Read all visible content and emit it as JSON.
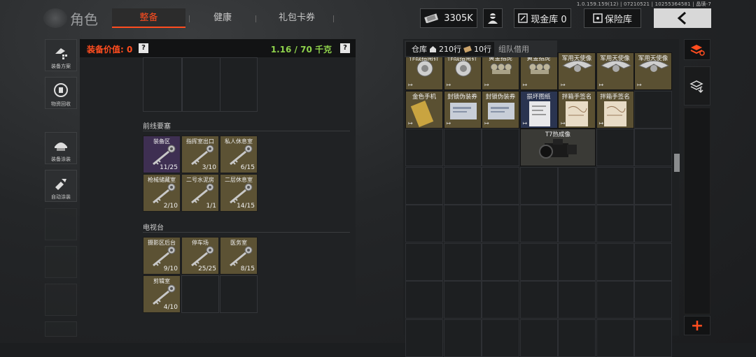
{
  "header": {
    "version": "1.0.159.159(12) | 07210521 | 10255364581 | 晶璜-7",
    "title": "角色",
    "tabs": [
      {
        "label": "整备",
        "active": true
      },
      {
        "label": "健康",
        "active": false
      },
      {
        "label": "礼包卡券",
        "active": false
      }
    ],
    "currency": "3305K",
    "cash_vault": "现金库 0",
    "safe_box": "保险库"
  },
  "sidebar": {
    "items": [
      {
        "label": "装备方案",
        "icon": "armor-plan-icon"
      },
      {
        "label": "物资回收",
        "icon": "recycle-icon"
      },
      {
        "label": "装备涂装",
        "icon": "helmet-paint-icon"
      },
      {
        "label": "自动涂装",
        "icon": "auto-paint-icon"
      }
    ]
  },
  "equipment": {
    "value_label": "装备价值: 0",
    "weight": "1.16 / 70 千克",
    "help": "?",
    "sections": [
      {
        "title": "前线要塞",
        "keys": [
          {
            "name": "装备区",
            "count": "11/25",
            "rarity": "purple"
          },
          {
            "name": "指挥室出口",
            "count": "3/10",
            "rarity": "gold"
          },
          {
            "name": "私人休息室",
            "count": "6/15",
            "rarity": "gold"
          },
          {
            "name": "枪械储藏室",
            "count": "2/10",
            "rarity": "gold"
          },
          {
            "name": "二号水泥房",
            "count": "1/1",
            "rarity": "gold"
          },
          {
            "name": "二层休息室",
            "count": "14/15",
            "rarity": "gold"
          }
        ]
      },
      {
        "title": "电视台",
        "keys": [
          {
            "name": "摄影区后台",
            "count": "9/10",
            "rarity": "gold"
          },
          {
            "name": "停车场",
            "count": "25/25",
            "rarity": "gold"
          },
          {
            "name": "医务室",
            "count": "8/15",
            "rarity": "gold"
          },
          {
            "name": "剪辑室",
            "count": "4/10",
            "rarity": "gold"
          }
        ]
      }
    ]
  },
  "warehouse": {
    "tab_label": "仓库",
    "rows": "210行",
    "rows_extra": "10行",
    "team_tab": "组队借用",
    "row1": [
      {
        "name": "作战指南针",
        "rarity": "gold"
      },
      {
        "name": "作战指南针",
        "rarity": "gold"
      },
      {
        "name": "黄金指虎",
        "rarity": "gold"
      },
      {
        "name": "黄金指虎",
        "rarity": "gold"
      },
      {
        "name": "军用天使像",
        "rarity": "gold"
      },
      {
        "name": "军用天使像",
        "rarity": "gold"
      },
      {
        "name": "军用天使像",
        "rarity": "gold"
      }
    ],
    "row2": [
      {
        "name": "金色手机",
        "rarity": "gold"
      },
      {
        "name": "封锁伪装券",
        "rarity": "gold"
      },
      {
        "name": "封锁伪装券",
        "rarity": "gold"
      },
      {
        "name": "损坏图纸",
        "rarity": "blue"
      },
      {
        "name": "拌箱手签名",
        "rarity": "gold"
      },
      {
        "name": "拌箱手签名",
        "rarity": "gold"
      }
    ],
    "thermal": {
      "name": "T7热成像",
      "rarity": "dark"
    }
  },
  "right_column": {
    "add": "+"
  },
  "colors": {
    "accent": "#ff4d1f",
    "weight": "#8ed14b",
    "gold": "#5a5032",
    "purple": "#3e2f52"
  }
}
